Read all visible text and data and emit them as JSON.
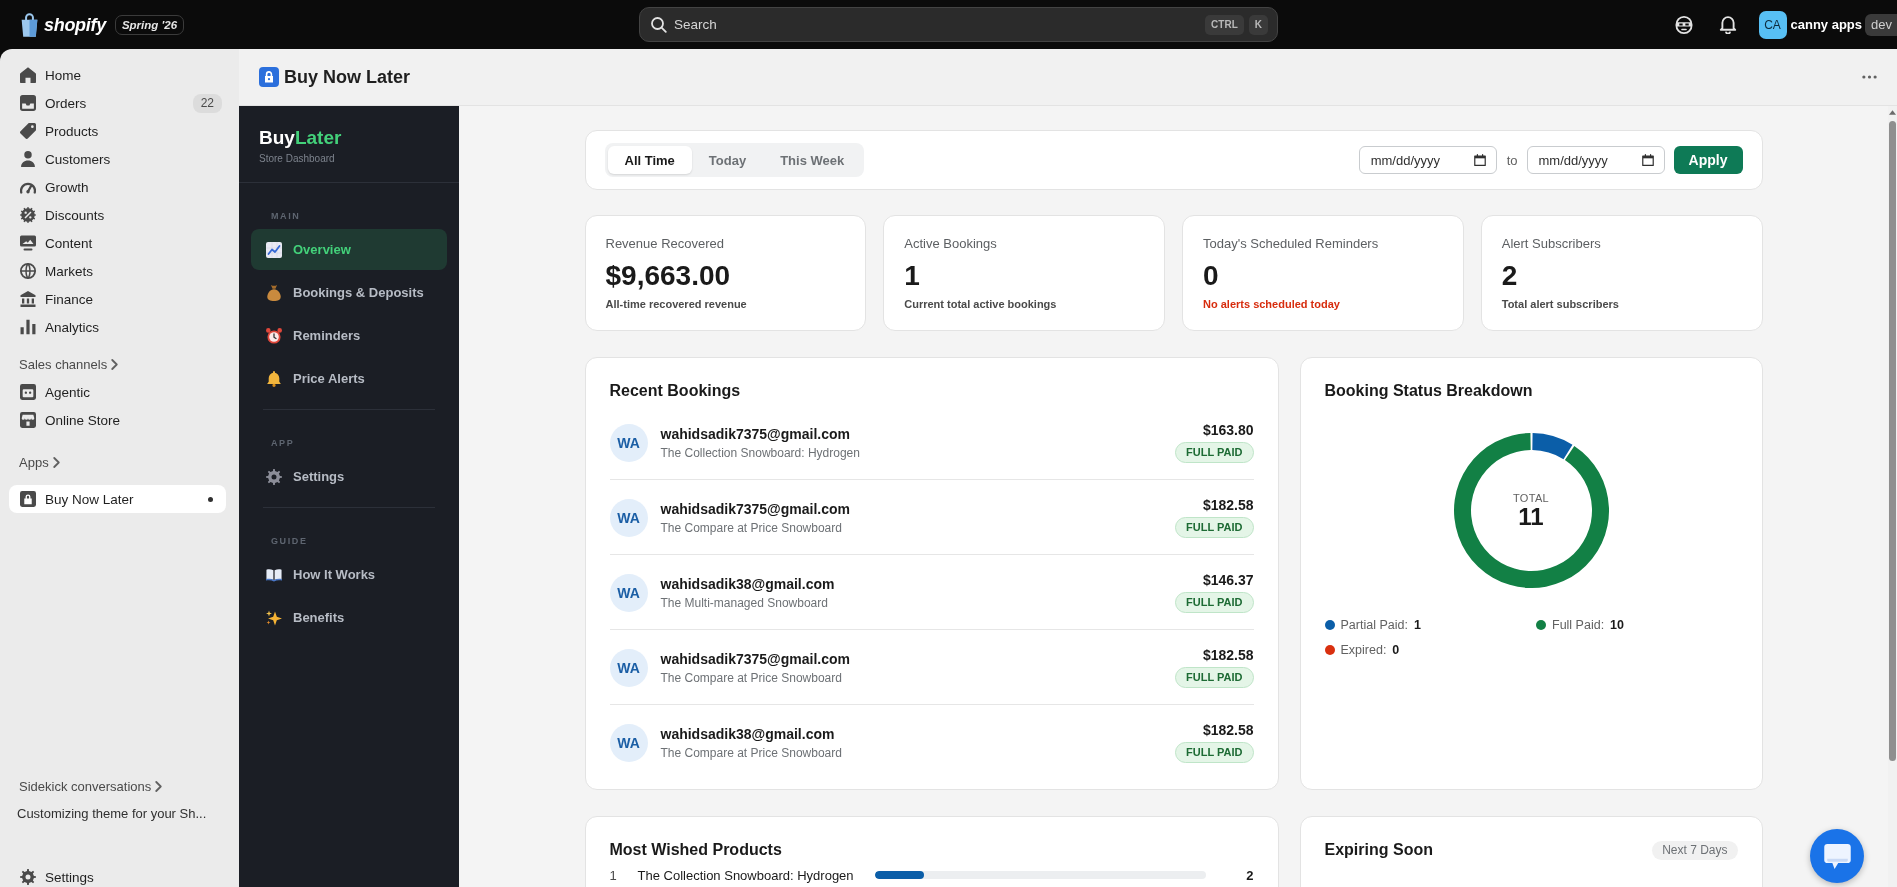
{
  "top_bar": {
    "brand": "shopify",
    "edition": "Spring '26",
    "search": {
      "placeholder": "Search",
      "keys": [
        "CTRL",
        "K"
      ]
    },
    "account": {
      "initials": "CA",
      "name": "canny apps",
      "badge": "dev"
    }
  },
  "nav": {
    "items": [
      {
        "label": "Home",
        "selected": false
      },
      {
        "label": "Orders",
        "count": "22",
        "selected": false
      },
      {
        "label": "Products",
        "selected": false
      },
      {
        "label": "Customers",
        "selected": false
      },
      {
        "label": "Growth",
        "selected": false
      },
      {
        "label": "Discounts",
        "selected": false
      },
      {
        "label": "Content",
        "selected": false
      },
      {
        "label": "Markets",
        "selected": false
      },
      {
        "label": "Finance",
        "selected": false
      },
      {
        "label": "Analytics",
        "selected": false
      }
    ],
    "sales_channels": {
      "heading": "Sales channels",
      "items": [
        {
          "label": "Agentic",
          "selected": false
        },
        {
          "label": "Online Store",
          "selected": false
        }
      ]
    },
    "apps": {
      "heading": "Apps",
      "items": [
        {
          "label": "Buy Now Later",
          "selected": true
        }
      ]
    },
    "sidekick": {
      "heading": "Sidekick conversations",
      "items": [
        {
          "label": "Customizing theme for your Sh..."
        }
      ]
    },
    "settings": {
      "label": "Settings"
    }
  },
  "app_header": {
    "title": "Buy Now Later"
  },
  "app_nav": {
    "logo": {
      "lead": "Buy",
      "accent": "Later"
    },
    "tagline": "Store Dashboard",
    "sections": [
      {
        "heading": "MAIN",
        "items": [
          {
            "label": "Overview",
            "selected": true
          },
          {
            "label": "Bookings & Deposits",
            "selected": false
          },
          {
            "label": "Reminders",
            "selected": false
          },
          {
            "label": "Price Alerts",
            "selected": false
          }
        ]
      },
      {
        "heading": "APP",
        "items": [
          {
            "label": "Settings",
            "selected": false
          }
        ]
      },
      {
        "heading": "GUIDE",
        "items": [
          {
            "label": "How It Works",
            "selected": false
          },
          {
            "label": "Benefits",
            "selected": false
          }
        ]
      }
    ]
  },
  "filter": {
    "ranges": [
      {
        "label": "All Time",
        "selected": true
      },
      {
        "label": "Today",
        "selected": false
      },
      {
        "label": "This Week",
        "selected": false
      }
    ],
    "date_from": {
      "placeholder": "mm/dd/yyyy"
    },
    "to_label": "to",
    "date_to": {
      "placeholder": "mm/dd/yyyy"
    },
    "apply": "Apply"
  },
  "stats": [
    {
      "label": "Revenue Recovered",
      "value": "$9,663.00",
      "note": "All-time recovered revenue",
      "kind": "info"
    },
    {
      "label": "Active Bookings",
      "value": "1",
      "note": "Current total active bookings",
      "kind": "info"
    },
    {
      "label": "Today's Scheduled Reminders",
      "value": "0",
      "note": "No alerts scheduled today",
      "kind": "warning"
    },
    {
      "label": "Alert Subscribers",
      "value": "2",
      "note": "Total alert subscribers",
      "kind": "info"
    }
  ],
  "recent_bookings": {
    "title": "Recent Bookings",
    "rows": [
      {
        "initials": "WA",
        "email": "wahidsadik7375@gmail.com",
        "product": "The Collection Snowboard: Hydrogen",
        "amount": "$163.80",
        "status": "FULL PAID"
      },
      {
        "initials": "WA",
        "email": "wahidsadik7375@gmail.com",
        "product": "The Compare at Price Snowboard",
        "amount": "$182.58",
        "status": "FULL PAID"
      },
      {
        "initials": "WA",
        "email": "wahidsadik38@gmail.com",
        "product": "The Multi-managed Snowboard",
        "amount": "$146.37",
        "status": "FULL PAID"
      },
      {
        "initials": "WA",
        "email": "wahidsadik7375@gmail.com",
        "product": "The Compare at Price Snowboard",
        "amount": "$182.58",
        "status": "FULL PAID"
      },
      {
        "initials": "WA",
        "email": "wahidsadik38@gmail.com",
        "product": "The Compare at Price Snowboard",
        "amount": "$182.58",
        "status": "FULL PAID"
      }
    ]
  },
  "status_breakdown": {
    "title": "Booking Status Breakdown",
    "total_label": "TOTAL",
    "total_value": "11",
    "legend": [
      {
        "label": "Partial Paid:",
        "value": "1",
        "color": "#0b5ea8"
      },
      {
        "label": "Full Paid:",
        "value": "10",
        "color": "#128045"
      },
      {
        "label": "Expired:",
        "value": "0",
        "color": "#d9300f"
      }
    ],
    "chart_data": {
      "type": "donut",
      "values": [
        9.09,
        90.91,
        0
      ]
    }
  },
  "most_wished": {
    "title": "Most Wished Products",
    "rows": [
      {
        "rank": "1",
        "product": "The Collection Snowboard: Hydrogen",
        "level": 0.15,
        "count": "2"
      }
    ]
  },
  "expiring_soon": {
    "title": "Expiring Soon",
    "badge": "Next 7 Days"
  }
}
